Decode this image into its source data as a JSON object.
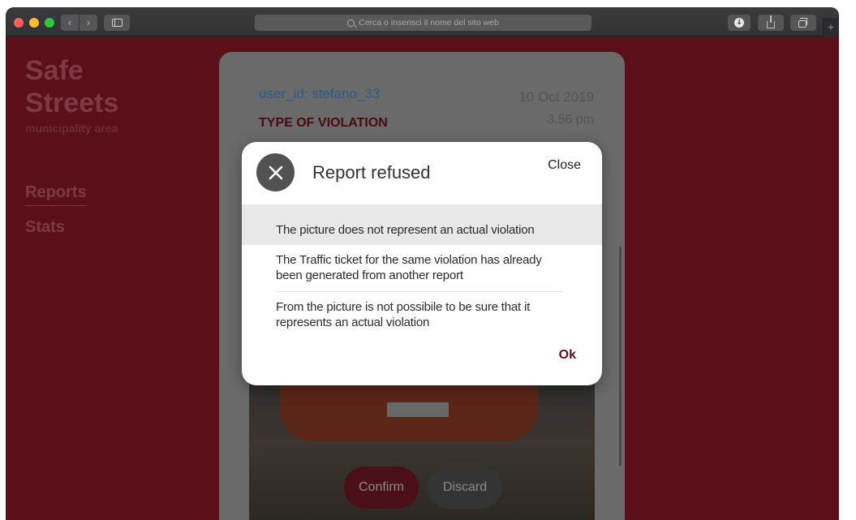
{
  "browser": {
    "address_placeholder": "Cerca o inserisci il nome del sito web",
    "icons": [
      "back-icon",
      "forward-icon",
      "sidebar-icon",
      "search-icon",
      "download-icon",
      "share-icon",
      "tabs-icon",
      "new-tab-icon"
    ],
    "new_tab_label": "+"
  },
  "sidebar": {
    "brand_line1": "Safe",
    "brand_line2": "Streets",
    "subtitle": "municipality area",
    "items": [
      {
        "label": "Reports",
        "active": true
      },
      {
        "label": "Stats",
        "active": false
      }
    ]
  },
  "report": {
    "user_id": "user_id: stefano_33",
    "date": "10 Oct 2019",
    "time": "3.56 pm",
    "type_heading": "TYPE OF VIOLATION",
    "confirm_label": "Confirm",
    "discard_label": "Discard"
  },
  "modal": {
    "title": "Report refused",
    "close_label": "Close",
    "options": [
      {
        "text": "The picture does not represent an actual violation",
        "selected": true
      },
      {
        "text": "The Traffic ticket for the same violation has already been generated from another report",
        "selected": false
      },
      {
        "text": "From the picture is not possibile to be sure that it represents an actual violation",
        "selected": false
      }
    ],
    "ok_label": "Ok"
  },
  "colors": {
    "brand_bg": "#5b0f18",
    "accent": "#5b0f18",
    "selected_row": "#e8e8e8",
    "user_link": "#2c5b84"
  }
}
